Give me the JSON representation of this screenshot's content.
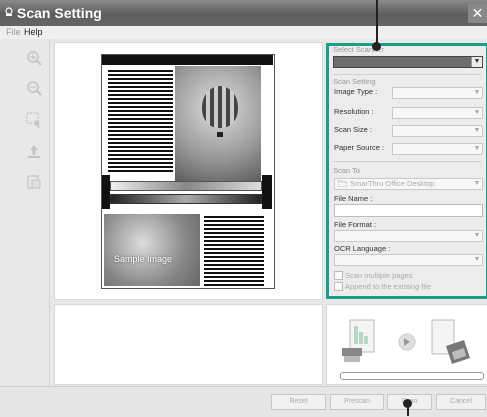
{
  "window": {
    "title": "Scan Setting",
    "close_glyph": "✕"
  },
  "menu": {
    "file": "File",
    "help": "Help"
  },
  "toolbar": {
    "tools": [
      "zoom-in",
      "zoom-out",
      "select-area",
      "rotate",
      "crop"
    ]
  },
  "preview": {
    "sample_text": "Sample Image"
  },
  "settings": {
    "select_scanner_label": "Select Scanner",
    "scan_setting_group": "Scan Setting",
    "image_type_label": "Image Type :",
    "resolution_label": "Resolution :",
    "scan_size_label": "Scan Size :",
    "paper_source_label": "Paper Source :",
    "scan_to_group": "Scan To",
    "scan_to_value": "SmarThru Office Desktop",
    "file_name_label": "File Name :",
    "file_format_label": "File Format :",
    "ocr_language_label": "OCR Language :",
    "scan_multiple_pages": "Scan multiple pages",
    "append_existing": "Append to the existing file"
  },
  "buttons": {
    "reset": "Reset",
    "prescan": "Prescan",
    "scan": "Scan",
    "cancel": "Cancel"
  },
  "colors": {
    "highlight": "#18a086"
  }
}
